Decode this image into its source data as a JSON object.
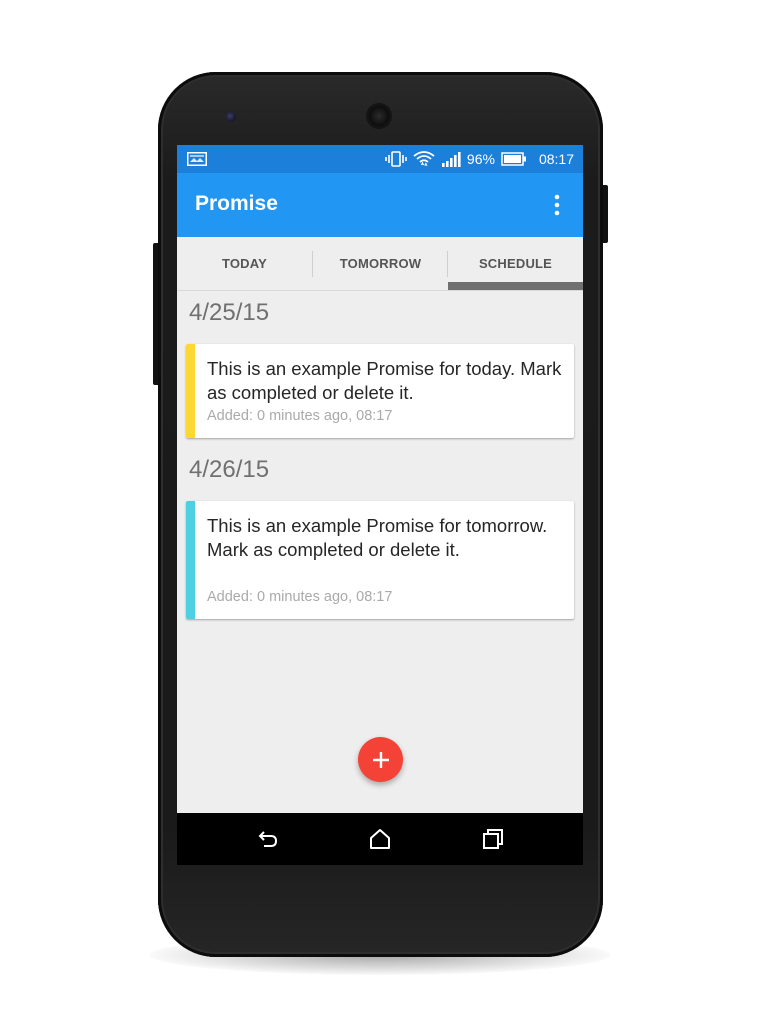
{
  "status_bar": {
    "battery_percent": "96%",
    "time": "08:17",
    "icons": [
      "photo-notification-icon",
      "vibrate-icon",
      "wifi-icon",
      "signal-icon",
      "battery-icon"
    ]
  },
  "app_bar": {
    "title": "Promise",
    "overflow_icon": "more-vert-icon"
  },
  "tabs": [
    {
      "label": "TODAY",
      "selected": false
    },
    {
      "label": "TOMORROW",
      "selected": false
    },
    {
      "label": "SCHEDULE",
      "selected": true
    }
  ],
  "groups": [
    {
      "date": "4/25/15",
      "items": [
        {
          "text": "This is an example Promise for today. Mark as completed or delete it.",
          "meta": "Added: 0 minutes ago, 08:17",
          "color": "#fdd835"
        }
      ]
    },
    {
      "date": "4/26/15",
      "items": [
        {
          "text": "This is an example Promise for tomorrow. Mark as completed or delete it.",
          "meta": "Added: 0 minutes ago, 08:17",
          "color": "#4dd0e1"
        }
      ]
    }
  ],
  "fab": {
    "icon": "plus-icon",
    "color": "#f44336"
  },
  "nav_bar": {
    "icons": [
      "back-icon",
      "home-icon",
      "recents-icon"
    ]
  },
  "colors": {
    "status_bar": "#1c7fd9",
    "app_bar": "#2196f3",
    "background": "#eeeeee"
  }
}
